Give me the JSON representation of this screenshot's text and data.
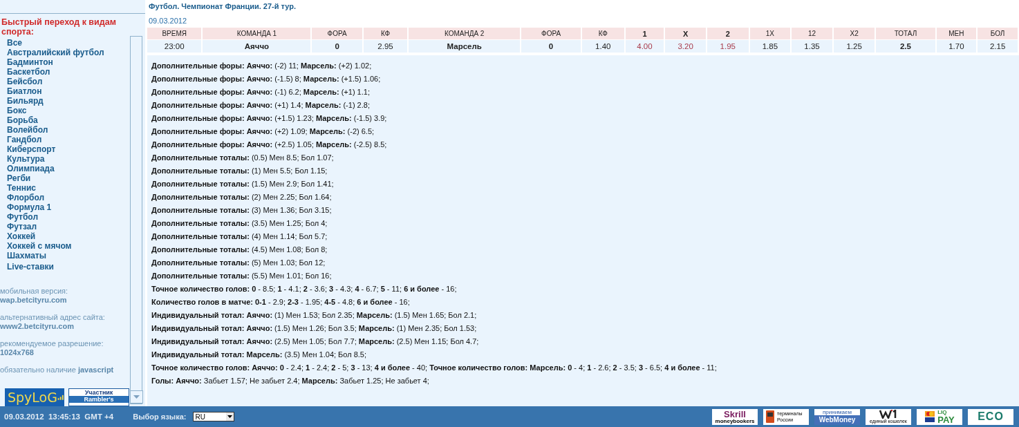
{
  "sidebar": {
    "heading": "Быстрый переход к видам спорта:",
    "sports": [
      "Все",
      "Австралийский футбол",
      "Бадминтон",
      "Баскетбол",
      "Бейсбол",
      "Биатлон",
      "Бильярд",
      "Бокс",
      "Борьба",
      "Волейбол",
      "Гандбол",
      "Киберспорт",
      "Культура",
      "Олимпиада",
      "Регби",
      "Теннис",
      "Флорбол",
      "Формула 1",
      "Футбол",
      "Футзал",
      "Хоккей",
      "Хоккей с мячом",
      "Шахматы",
      "Live-ставки"
    ],
    "info": [
      {
        "label": "мобильная версия:",
        "value": "wap.betcityru.com"
      },
      {
        "label": "альтернативный адрес сайта:",
        "value": "www2.betcityru.com"
      },
      {
        "label": "рекомендуемое разрешение:",
        "value": "1024x768"
      }
    ],
    "note": "обязательно наличие **javascript**",
    "spylog": "SpyLoG",
    "rambler": [
      "Участник",
      "Rambler's"
    ]
  },
  "event": {
    "title": "Футбол. Чемпионат Франции. 27-й тур.",
    "date": "09.03.2012"
  },
  "table": {
    "columns": [
      {
        "label": "ВРЕМЯ",
        "bold": false
      },
      {
        "label": "КОМАНДА 1",
        "bold": false
      },
      {
        "label": "ФОРА",
        "bold": false
      },
      {
        "label": "КФ",
        "bold": false
      },
      {
        "label": "КОМАНДА 2",
        "bold": false
      },
      {
        "label": "ФОРА",
        "bold": false
      },
      {
        "label": "КФ",
        "bold": false
      },
      {
        "label": "1",
        "bold": true
      },
      {
        "label": "X",
        "bold": true
      },
      {
        "label": "2",
        "bold": true
      },
      {
        "label": "1X",
        "bold": false
      },
      {
        "label": "12",
        "bold": false
      },
      {
        "label": "X2",
        "bold": false
      },
      {
        "label": "ТОТАЛ",
        "bold": false
      },
      {
        "label": "МЕН",
        "bold": false
      },
      {
        "label": "БОЛ",
        "bold": false
      }
    ],
    "rows": [
      [
        {
          "text": "23:00",
          "kind": "plain"
        },
        {
          "text": "Аяччо",
          "kind": "bold"
        },
        {
          "text": "0",
          "kind": "bold"
        },
        {
          "text": "2.95",
          "kind": "plain"
        },
        {
          "text": "Марсель",
          "kind": "bold"
        },
        {
          "text": "0",
          "kind": "bold"
        },
        {
          "text": "1.40",
          "kind": "plain"
        },
        {
          "text": "4.00",
          "kind": "outcome"
        },
        {
          "text": "3.20",
          "kind": "outcome"
        },
        {
          "text": "1.95",
          "kind": "outcome"
        },
        {
          "text": "1.85",
          "kind": "plain"
        },
        {
          "text": "1.35",
          "kind": "plain"
        },
        {
          "text": "1.25",
          "kind": "plain"
        },
        {
          "text": "2.5",
          "kind": "bold"
        },
        {
          "text": "1.70",
          "kind": "plain"
        },
        {
          "text": "2.15",
          "kind": "plain"
        }
      ]
    ]
  },
  "details": [
    "**Дополнительные форы: Аяччо:** (-2) 11; **Марсель:** (+2) 1.02;",
    "**Дополнительные форы: Аяччо:** (-1.5) 8; **Марсель:** (+1.5) 1.06;",
    "**Дополнительные форы: Аяччо:** (-1) 6.2; **Марсель:** (+1) 1.1;",
    "**Дополнительные форы: Аяччо:** (+1) 1.4; **Марсель:** (-1) 2.8;",
    "**Дополнительные форы: Аяччо:** (+1.5) 1.23; **Марсель:** (-1.5) 3.9;",
    "**Дополнительные форы: Аяччо:** (+2) 1.09; **Марсель:** (-2) 6.5;",
    "**Дополнительные форы: Аяччо:** (+2.5) 1.05; **Марсель:** (-2.5) 8.5;",
    "**Дополнительные тоталы:** (0.5) Мен 8.5; Бол 1.07;",
    "**Дополнительные тоталы:** (1) Мен 5.5; Бол 1.15;",
    "**Дополнительные тоталы:** (1.5) Мен 2.9; Бол 1.41;",
    "**Дополнительные тоталы:** (2) Мен 2.25; Бол 1.64;",
    "**Дополнительные тоталы:** (3) Мен 1.36; Бол 3.15;",
    "**Дополнительные тоталы:** (3.5) Мен 1.25; Бол 4;",
    "**Дополнительные тоталы:** (4) Мен 1.14; Бол 5.7;",
    "**Дополнительные тоталы:** (4.5) Мен 1.08; Бол 8;",
    "**Дополнительные тоталы:** (5) Мен 1.03; Бол 12;",
    "**Дополнительные тоталы:** (5.5) Мен 1.01; Бол 16;",
    "**Точное количество голов: 0** - 8.5; **1** - 4.1; **2** - 3.6; **3** - 4.3; **4** - 6.7; **5** - 11; **6 и более** - 16;",
    "**Количество голов в матче: 0-1** - 2.9; **2-3** - 1.95; **4-5** - 4.8; **6 и более** - 16;",
    "**Индивидуальный тотал: Аяччо:** (1) Мен 1.53; Бол 2.35; **Марсель:** (1.5) Мен 1.65; Бол 2.1;",
    "**Индивидуальный тотал: Аяччо:** (1.5) Мен 1.26; Бол 3.5; **Марсель:** (1) Мен 2.35; Бол 1.53;",
    "**Индивидуальный тотал: Аяччо:** (2.5) Мен 1.05; Бол 7.7; **Марсель:** (2.5) Мен 1.15; Бол 4.7;",
    "**Индивидуальный тотал: Марсель:** (3.5) Мен 1.04; Бол 8.5;",
    "**Точное количество голов: Аяччо: 0** - 2.4; **1** - 2.4; **2** - 5; **3** - 13; **4 и более** - 40; **Точное количество голов: Марсель: 0** - 4; **1** - 2.6; **2** - 3.5; **3** - 6.5; **4 и более** - 11;",
    "**Голы: Аяччо:** Забьет 1.57; Не забьет 2.4; **Марсель:** Забьет 1.25; Не забьет 4;"
  ],
  "status_bar": {
    "datetime": "09.03.2012  13:45:13  GMT +4",
    "language_label": "Выбор языка:",
    "language": "RU",
    "payments": [
      {
        "kind": "skrill",
        "lines": [
          "Skrill",
          "moneybookers"
        ]
      },
      {
        "kind": "terminal",
        "lines": [
          "терминалы",
          "России"
        ]
      },
      {
        "kind": "webmoney",
        "lines": [
          "принимаем",
          "WebMoney"
        ]
      },
      {
        "kind": "w1",
        "lines": [
          "единый кошелек"
        ]
      },
      {
        "kind": "liqpay",
        "lines": [
          "LIQ",
          "PAY"
        ]
      },
      {
        "kind": "eco",
        "lines": [
          "ECO"
        ]
      }
    ]
  }
}
